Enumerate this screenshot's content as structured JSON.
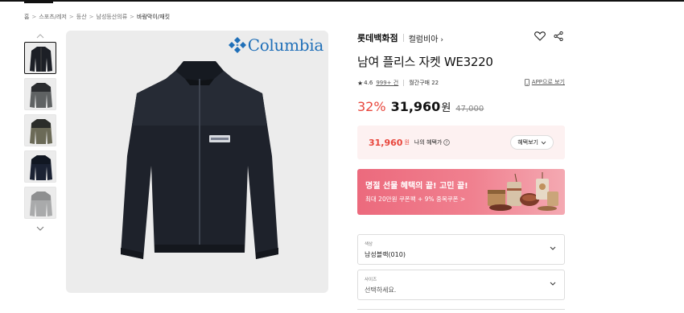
{
  "breadcrumb": [
    "홈",
    "스포츠/레저",
    "등산",
    "남성등산의류",
    "바람막이/재킷"
  ],
  "breadcrumb_separator": ">",
  "brand": {
    "logo_text": "Columbia",
    "logo_color": "#1f6fb8"
  },
  "product": {
    "store": "롯데백화점",
    "brand_name": "컬럼비아",
    "title": "남여 플리스 자켓 WE3220",
    "rating": "4.6",
    "review_count": "999+ 건",
    "monthly_purchases": "월간구매 22",
    "app_link": "APP으로 보기",
    "discount": "32%",
    "price": "31,960",
    "currency": "원",
    "original_price": "47,000"
  },
  "benefit": {
    "price": "31,960",
    "currency": "원",
    "label": "나의 혜택가",
    "button_label": "혜택보기"
  },
  "banner": {
    "title": "명절 선물 혜택의 끝! 고민 끝!",
    "subtitle": "최대 20만원 쿠폰팩 + 9% 중복쿠폰 >"
  },
  "options": [
    {
      "label": "색상",
      "value": "남성블랙(010)"
    },
    {
      "label": "사이즈",
      "value": "선택하세요."
    }
  ],
  "colors": {
    "accent": "#e8463c",
    "benefit_bg": "#fdf1f1",
    "banner_bg": "#ec6a7d"
  }
}
